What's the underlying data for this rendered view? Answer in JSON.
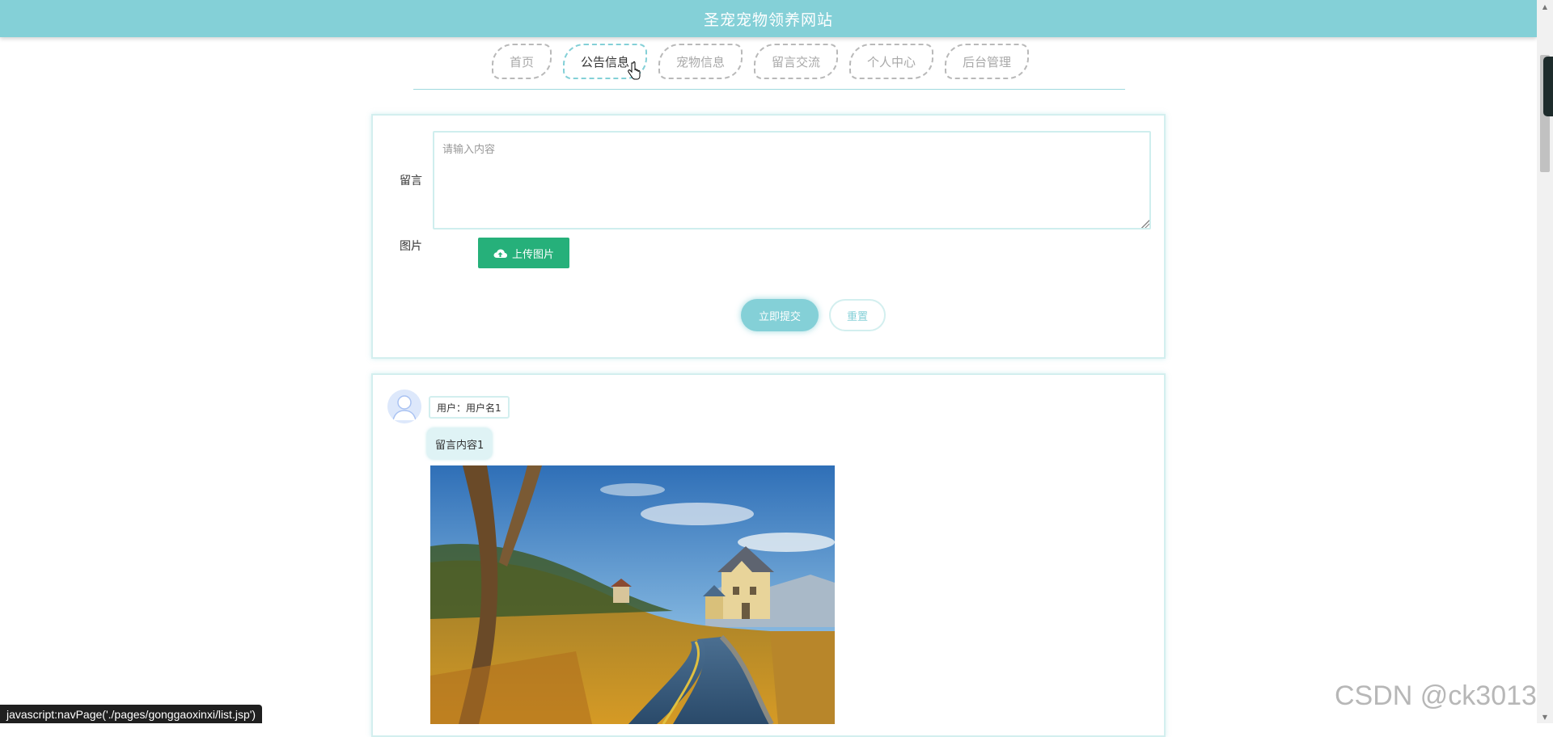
{
  "site": {
    "title": "圣宠宠物领养网站"
  },
  "nav": {
    "items": [
      {
        "label": "首页",
        "active": false
      },
      {
        "label": "公告信息",
        "active": true
      },
      {
        "label": "宠物信息",
        "active": false
      },
      {
        "label": "留言交流",
        "active": false
      },
      {
        "label": "个人中心",
        "active": false
      },
      {
        "label": "后台管理",
        "active": false
      }
    ]
  },
  "form": {
    "message_label": "留言",
    "message_placeholder": "请输入内容",
    "message_value": "",
    "image_label": "图片",
    "upload_label": "上传图片",
    "submit_label": "立即提交",
    "reset_label": "重置"
  },
  "messages": [
    {
      "user": "用户：用户名1",
      "content": "留言内容1",
      "photo": "landscape-photo"
    }
  ],
  "status_bar": {
    "text": "javascript:navPage('./pages/gonggaoxinxi/list.jsp')"
  },
  "watermark": {
    "text": "CSDN @ck3013"
  },
  "colors": {
    "primary": "#84d0d7",
    "upload": "#26b07a",
    "border": "#d3efef",
    "nav_inactive": "#b9b9b9"
  }
}
